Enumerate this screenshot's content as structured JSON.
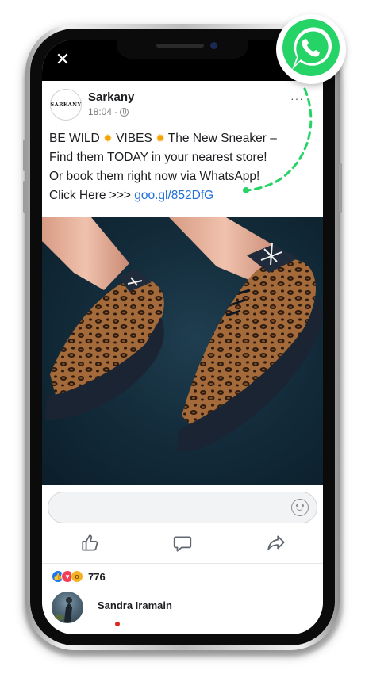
{
  "post": {
    "author": "Sarkany",
    "avatar_text": "SARKANY",
    "time": "18:04",
    "text_line1_a": "BE WILD ",
    "text_line1_b": " VIBES ",
    "text_line1_c": " The New Sneaker –",
    "text_line2": "Find them TODAY in your nearest store!",
    "text_line3": "Or book them right now via WhatsApp!",
    "text_line4": "Click Here >>>",
    "link": "goo.gl/852DfG",
    "sun_emoji": "✹",
    "more": "···"
  },
  "window": {
    "close_label": "✕"
  },
  "reactions": {
    "count": "776"
  },
  "comment": {
    "author": "Sandra Iramain"
  },
  "colors": {
    "whatsapp_green": "#25d366",
    "link_blue": "#216fdb",
    "facebook_blue": "#1877f2"
  },
  "icons": [
    "close-icon",
    "globe-icon",
    "more-icon",
    "smiley-icon",
    "like-icon",
    "comment-icon",
    "share-icon",
    "whatsapp-icon"
  ]
}
